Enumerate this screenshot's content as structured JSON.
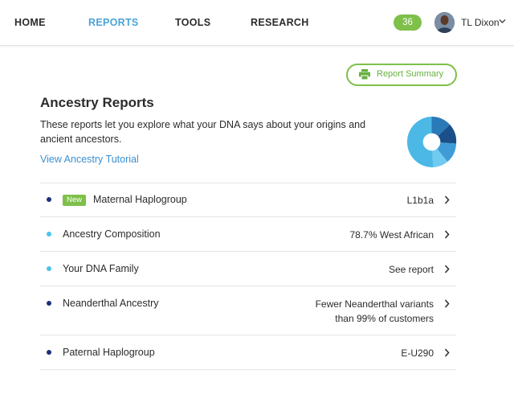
{
  "nav": {
    "items": [
      {
        "label": "HOME",
        "active": false
      },
      {
        "label": "REPORTS",
        "active": true
      },
      {
        "label": "TOOLS",
        "active": false
      },
      {
        "label": "RESEARCH",
        "active": false
      }
    ],
    "notification_count": "36",
    "user_name": "TL Dixon"
  },
  "summary_button": {
    "label": "Report Summary",
    "icon": "printer-icon"
  },
  "header": {
    "title": "Ancestry Reports",
    "description": "These reports let you explore what your DNA says about your origins and ancient ancestors.",
    "tutorial_link": "View Ancestry Tutorial"
  },
  "pie_icon": {
    "colors": [
      "#4bb8e6",
      "#2b7ab8",
      "#1a4f8a",
      "#3f9bd6",
      "#6fcbef"
    ]
  },
  "reports": [
    {
      "badge": "New",
      "label": "Maternal Haplogroup",
      "value": "L1b1a",
      "dot_color": "#1e2f7a"
    },
    {
      "badge": "",
      "label": "Ancestry Composition",
      "value": "78.7% West African",
      "dot_color": "#4cc3e8"
    },
    {
      "badge": "",
      "label": "Your DNA Family",
      "value": "See report",
      "dot_color": "#4cc3e8"
    },
    {
      "badge": "",
      "label": "Neanderthal Ancestry",
      "value_line1": "Fewer Neanderthal variants",
      "value_line2": "than 99% of customers",
      "dot_color": "#1e2f7a"
    },
    {
      "badge": "",
      "label": "Paternal Haplogroup",
      "value": "E-U290",
      "dot_color": "#1e2f7a"
    }
  ],
  "colors": {
    "accent_blue": "#4aa3d8",
    "accent_green": "#7ec04a",
    "link": "#3a8fd1"
  }
}
